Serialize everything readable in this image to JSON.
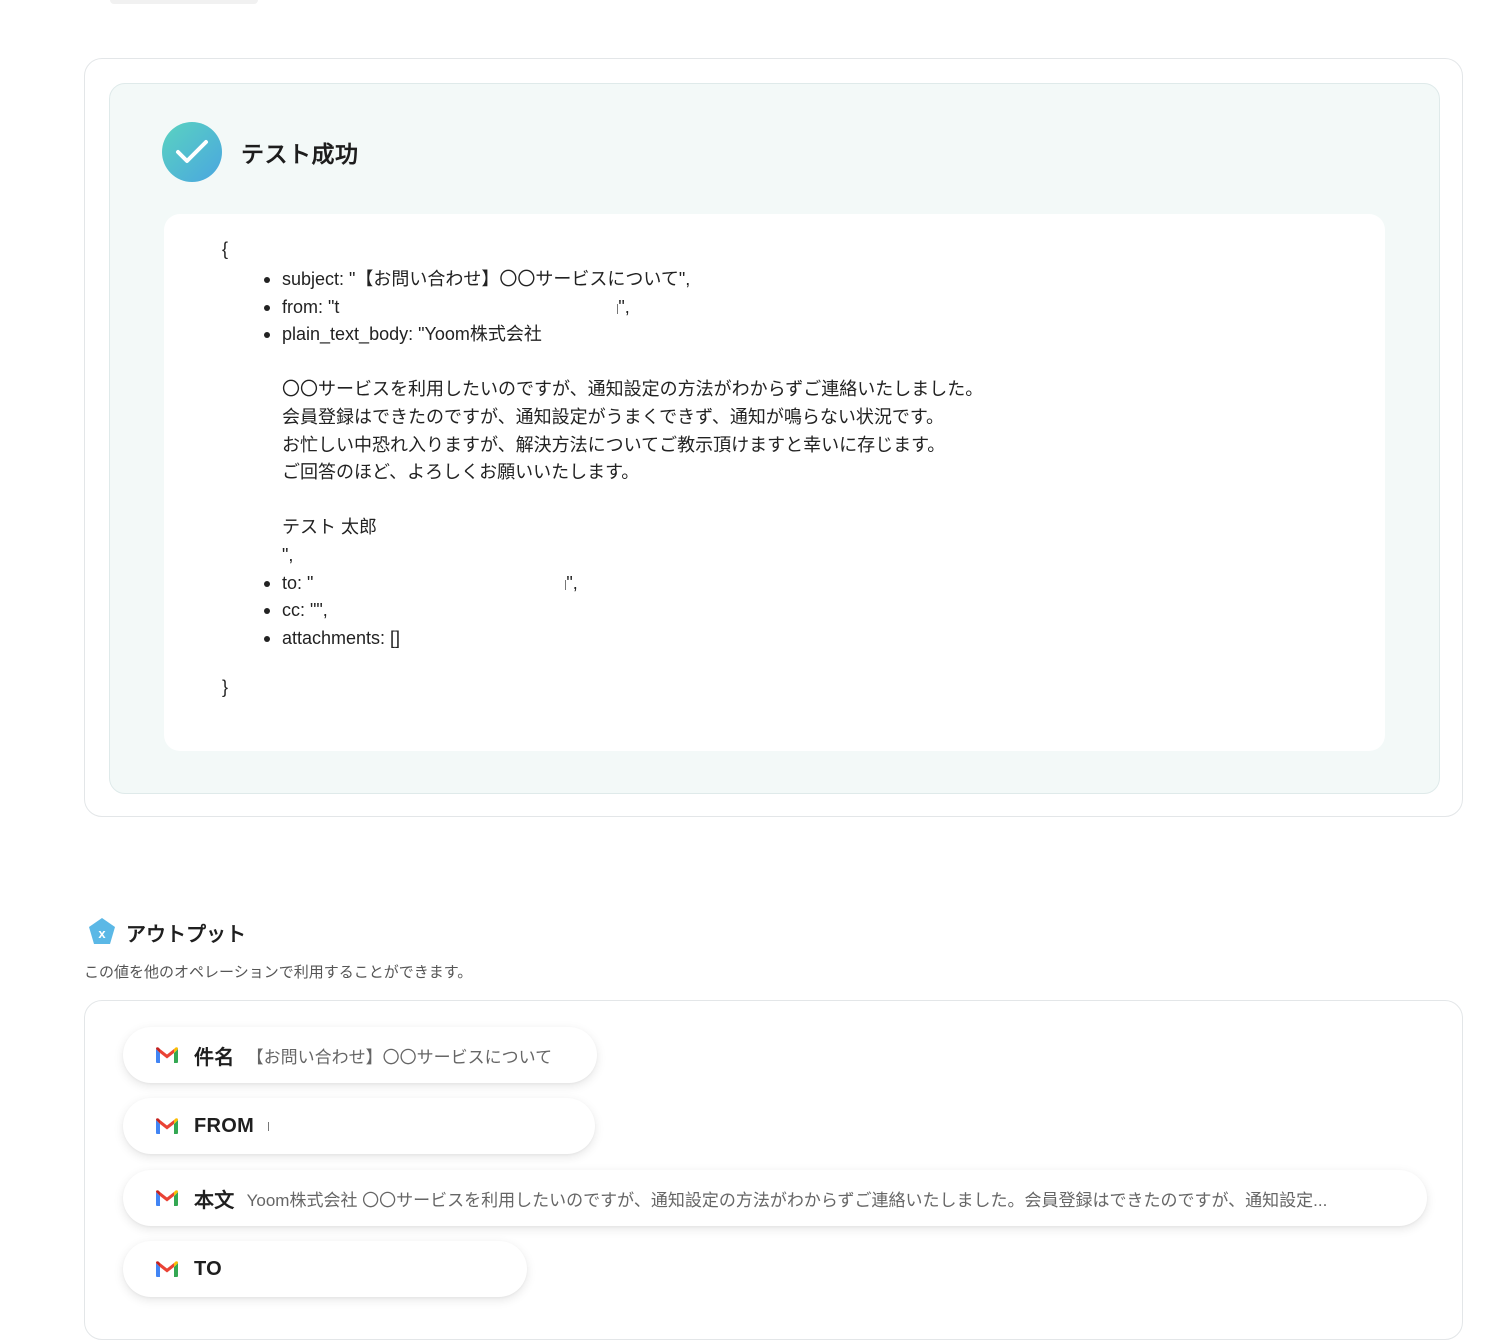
{
  "test_result": {
    "status_title": "テスト成功",
    "open_brace": "{",
    "close_brace": "}",
    "lines": [
      "subject: \"【お問い合わせ】〇〇サービスについて\",",
      "from: \"t",
      "plain_text_body: \"Yoom株式会社",
      "",
      "〇〇サービスを利用したいのですが、通知設定の方法がわからずご連絡いたしました。",
      "会員登録はできたのですが、通知設定がうまくできず、通知が鳴らない状況です。",
      "お忙しい中恐れ入りますが、解決方法についてご教示頂けますと幸いに存じます。",
      "ご回答のほど、よろしくお願いいたします。",
      "",
      "テスト 太郎",
      "\",",
      "to: \"",
      "cc: \"\",",
      "attachments: []"
    ],
    "from_suffix": "\",",
    "to_suffix": "\","
  },
  "output": {
    "title": "アウトプット",
    "description": "この値を他のオペレーションで利用することができます。",
    "icon": "variable-x-icon",
    "items": [
      {
        "label": "件名",
        "value": "【お問い合わせ】〇〇サービスについて",
        "icon": "gmail-icon"
      },
      {
        "label": "FROM",
        "value": "",
        "icon": "gmail-icon"
      },
      {
        "label": "本文",
        "value": "Yoom株式会社 〇〇サービスを利用したいのですが、通知設定の方法がわからずご連絡いたしました。会員登録はできたのですが、通知設定...",
        "icon": "gmail-icon"
      },
      {
        "label": "TO",
        "value": "",
        "icon": "gmail-icon"
      }
    ]
  },
  "colors": {
    "check_gradient_start": "#5ad3c0",
    "check_gradient_end": "#4aa6e0",
    "panel_bg": "#f3f9f8",
    "output_icon": "#5bb8e6"
  }
}
